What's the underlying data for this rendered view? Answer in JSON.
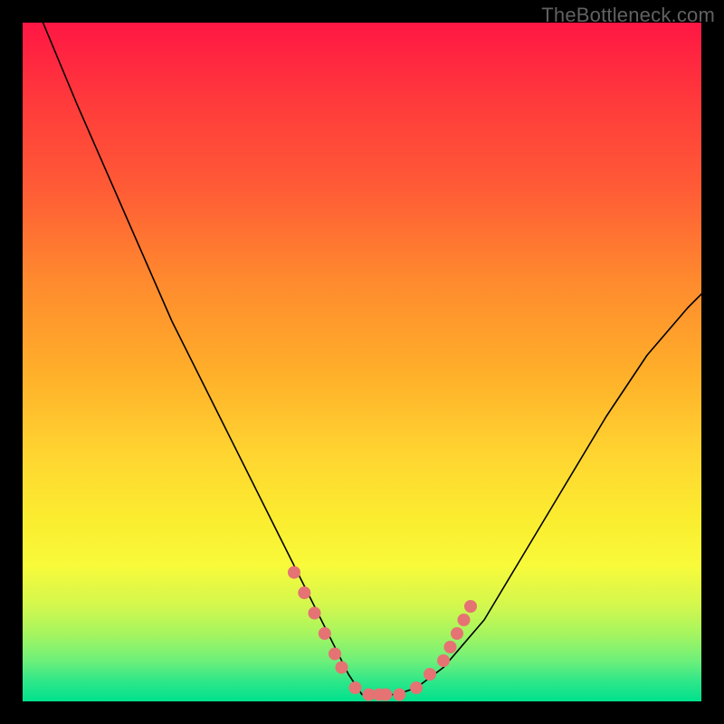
{
  "watermark": {
    "text": "TheBottleneck.com"
  },
  "colors": {
    "background": "#000000",
    "gradient_top": "#ff1744",
    "gradient_mid": "#ffd631",
    "gradient_bottom": "#00e18d",
    "curve": "#000000",
    "dots": "#e57373",
    "watermark_text": "#616161"
  },
  "chart_data": {
    "type": "line",
    "title": "",
    "xlabel": "",
    "ylabel": "",
    "xlim": [
      0,
      100
    ],
    "ylim": [
      0,
      100
    ],
    "grid": false,
    "legend": null,
    "series": [
      {
        "name": "bottleneck-curve",
        "x": [
          3,
          8,
          15,
          22,
          30,
          38,
          44,
          48,
          50,
          52,
          55,
          58,
          62,
          68,
          74,
          80,
          86,
          92,
          98,
          100
        ],
        "y": [
          100,
          88,
          72,
          56,
          40,
          24,
          12,
          4,
          1,
          1,
          1,
          2,
          5,
          12,
          22,
          32,
          42,
          51,
          58,
          60
        ]
      }
    ],
    "markers": {
      "name": "left-and-right-slope-dots",
      "x": [
        40,
        41.5,
        43,
        44.5,
        46,
        47,
        49,
        51,
        52.5,
        53.5,
        55.5,
        58,
        60,
        62,
        63,
        64,
        65,
        66
      ],
      "y": [
        19,
        16,
        13,
        10,
        7,
        5,
        2,
        1,
        1,
        1,
        1,
        2,
        4,
        6,
        8,
        10,
        12,
        14
      ]
    }
  }
}
